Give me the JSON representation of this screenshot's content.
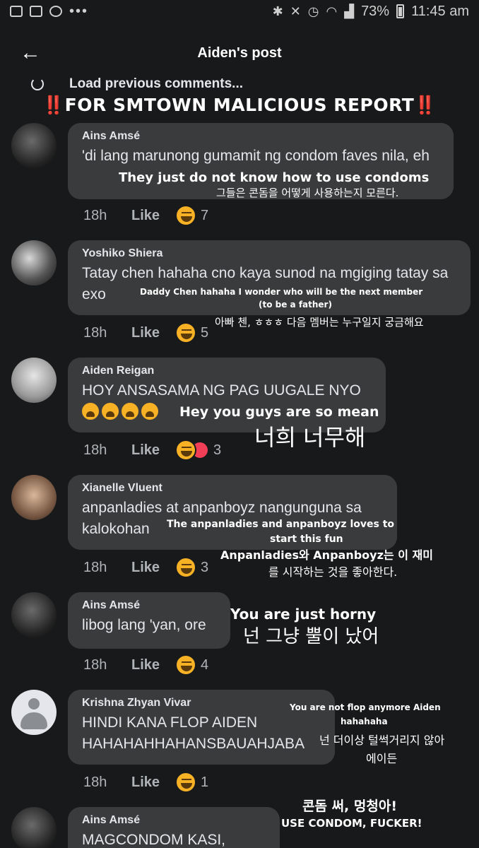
{
  "status_bar": {
    "battery": "73%",
    "time": "11:45 am",
    "dots": "•••"
  },
  "header": {
    "back_icon": "arrow-left-icon",
    "title": "Aiden's post"
  },
  "load_previous": "Load previous comments...",
  "banner": {
    "bang": "‼️",
    "text": "FOR SMTOWN MALICIOUS REPORT"
  },
  "comments": [
    {
      "author": "Ains Amsé",
      "text": "'di lang marunong gumamit ng condom faves nila, eh",
      "time": "18h",
      "like": "Like",
      "reactions": "7",
      "translation_en": "They just do not know how to use condoms",
      "translation_ko": "그들은 콘돔을 어떻게 사용하는지 모른다."
    },
    {
      "author": "Yoshiko Shiera",
      "text": "Tatay chen hahaha cno kaya sunod na mgiging tatay sa exo",
      "time": "18h",
      "like": "Like",
      "reactions": "5",
      "translation_en": "Daddy Chen hahaha I wonder who will be the next member",
      "translation_en2": "(to be a father)",
      "translation_ko": "아빠 첸, ㅎㅎㅎ 다음 멤버는 누구일지 궁금해요"
    },
    {
      "author": "Aiden Reigan",
      "text": "HOY ANSASAMA NG PAG UUGALE NYO",
      "time": "18h",
      "like": "Like",
      "reactions": "3",
      "translation_en": "Hey you guys are so mean",
      "translation_ko": "너희  너무해"
    },
    {
      "author": "Xianelle Vluent",
      "text": "anpanladies at anpanboyz nangunguna sa kalokohan",
      "time": "18h",
      "like": "Like",
      "reactions": "3",
      "translation_en": "The anpanladies and anpanboyz loves to",
      "translation_en2": "start this fun",
      "translation_ko": "Anpanladies와 Anpanboyz는 이 재미",
      "translation_ko2": "를 시작하는 것을 좋아한다."
    },
    {
      "author": "Ains Amsé",
      "text": "libog lang 'yan, ore",
      "time": "18h",
      "like": "Like",
      "reactions": "4",
      "translation_en": "You are just horny",
      "translation_ko": "넌 그냥 뿔이 났어"
    },
    {
      "author": "Krishna Zhyan Vivar",
      "text": "HINDI KANA FLOP AIDEN HAHAHAHHAHANSBAUAHJABA",
      "time": "18h",
      "like": "Like",
      "reactions": "1",
      "translation_en": "You are not flop anymore Aiden",
      "translation_en2": "hahahaha",
      "translation_ko": "넌 더이상 털썩거리지 않아",
      "translation_ko2": "에이든"
    },
    {
      "author": "Ains Amsé",
      "text": "MAGCONDOM KASI, ULOL",
      "translation_ko": "콘돔 써, 멍청아!",
      "translation_en": "USE CONDOM, FUCKER!"
    }
  ]
}
